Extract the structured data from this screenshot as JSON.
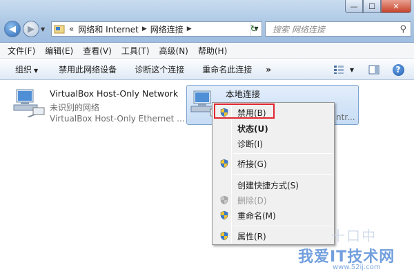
{
  "window": {
    "minimize_glyph": "—",
    "maximize_glyph": "☐",
    "close_glyph": "✕"
  },
  "nav": {
    "back_glyph": "◀",
    "forward_glyph": "▶",
    "history_glyph": "▼"
  },
  "address": {
    "overflow": "«",
    "segments": [
      "网络和 Internet",
      "网络连接"
    ],
    "separator_glyph": "▶",
    "dropdown_glyph": "▼",
    "refresh_glyph": "↻"
  },
  "search": {
    "placeholder": "搜索 网络连接",
    "icon_glyph": "⚲"
  },
  "menubar": [
    "文件(F)",
    "编辑(E)",
    "查看(V)",
    "工具(T)",
    "高级(N)",
    "帮助(H)"
  ],
  "commandbar": {
    "organize": "组织",
    "organize_arrow": "▼",
    "disable_device": "禁用此网络设备",
    "diagnose": "诊断这个连接",
    "rename": "重命名此连接",
    "more": "»",
    "views_arrow": "▼",
    "help_glyph": "?"
  },
  "connections": [
    {
      "name": "VirtualBox Host-Only Network",
      "status": "未识别的网络",
      "device": "VirtualBox Host-Only Ethernet ..."
    },
    {
      "name": "本地连接",
      "device_tail": "ntr..."
    }
  ],
  "context_menu": {
    "items": [
      {
        "label": "禁用(B)"
      },
      {
        "label": "状态(U)"
      },
      {
        "label": "诊断(I)"
      },
      {
        "label": "桥接(G)"
      },
      {
        "label": "创建快捷方式(S)"
      },
      {
        "label": "删除(D)"
      },
      {
        "label": "重命名(M)"
      },
      {
        "label": "属性(R)"
      }
    ]
  },
  "watermark": {
    "logo": "十口中",
    "text": "我爱IT技术网",
    "url": "www.52ij.com"
  },
  "colors": {
    "accent": "#2a67b5",
    "highlight_border": "#e0262f",
    "selection_bg": "#c6dcf5"
  }
}
